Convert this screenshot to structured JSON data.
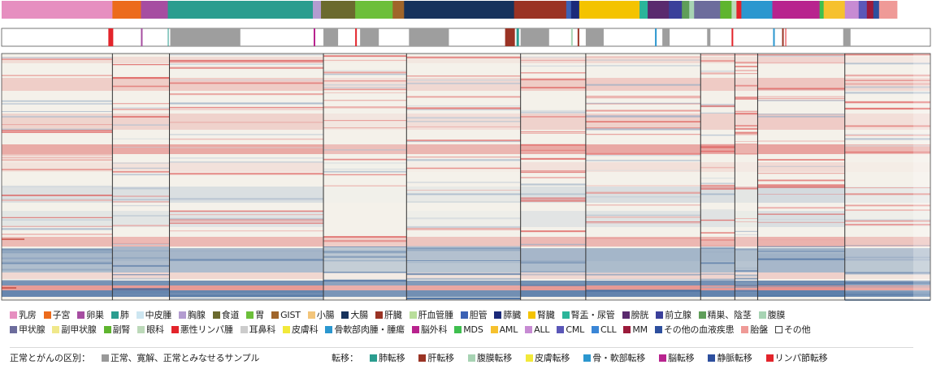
{
  "chart_data": {
    "type": "heatmap",
    "columns": 1140,
    "color_scale": {
      "low": "#1f4f8f",
      "mid": "#f5f3ec",
      "high": "#d72b2b"
    },
    "cancer_types": [
      {
        "label": "乳房",
        "color": "#e68fc0",
        "n": 136
      },
      {
        "label": "子宮",
        "color": "#ec6b1c",
        "n": 35
      },
      {
        "label": "卵巣",
        "color": "#a64da1",
        "n": 33
      },
      {
        "label": "肺",
        "color": "#2a9d8f",
        "n": 178
      },
      {
        "label": "中皮腫",
        "color": "#cde6f1",
        "n": 0
      },
      {
        "label": "胸腺",
        "color": "#b39cd0",
        "n": 10
      },
      {
        "label": "食道",
        "color": "#6b6a2e",
        "n": 42
      },
      {
        "label": "胃",
        "color": "#6cbf3a",
        "n": 46
      },
      {
        "label": "GIST",
        "color": "#a0652a",
        "n": 14
      },
      {
        "label": "小腸",
        "color": "#f3c57a",
        "n": 0
      },
      {
        "label": "大腸",
        "color": "#16325c",
        "n": 135
      },
      {
        "label": "肝臓",
        "color": "#9a3324",
        "n": 64
      },
      {
        "label": "肝血管腫",
        "color": "#b9de9b",
        "n": 0
      },
      {
        "label": "胆管",
        "color": "#3c62b5",
        "n": 6
      },
      {
        "label": "膵臓",
        "color": "#1b2a7a",
        "n": 10
      },
      {
        "label": "腎臓",
        "color": "#f4c300",
        "n": 74
      },
      {
        "label": "腎盂・尿管",
        "color": "#2bb59a",
        "n": 10
      },
      {
        "label": "膀胱",
        "color": "#5a2a6e",
        "n": 26
      },
      {
        "label": "前立腺",
        "color": "#3a3f9a",
        "n": 16
      },
      {
        "label": "精巣、陰茎",
        "color": "#5f9e59",
        "n": 9
      },
      {
        "label": "腹膜",
        "color": "#a7d3b3",
        "n": 6
      },
      {
        "label": "甲状腺",
        "color": "#6c6c9c",
        "n": 32
      },
      {
        "label": "副甲状腺",
        "color": "#f0e88a",
        "n": 0
      },
      {
        "label": "副腎",
        "color": "#5fb52f",
        "n": 14
      },
      {
        "label": "眼科",
        "color": "#bcd9b9",
        "n": 6
      },
      {
        "label": "悪性リンパ腫",
        "color": "#e3242b",
        "n": 6
      },
      {
        "label": "耳鼻科",
        "color": "#cccccc",
        "n": 0
      },
      {
        "label": "皮膚科",
        "color": "#f2e93a",
        "n": 0
      },
      {
        "label": "骨軟部肉腫・腫瘍",
        "color": "#2b97cf",
        "n": 38
      },
      {
        "label": "脳外科",
        "color": "#b8238e",
        "n": 58
      },
      {
        "label": "MDS",
        "color": "#3fbf4f",
        "n": 5
      },
      {
        "label": "AML",
        "color": "#f6c12e",
        "n": 26
      },
      {
        "label": "ALL",
        "color": "#c78bd3",
        "n": 17
      },
      {
        "label": "CML",
        "color": "#5b57b8",
        "n": 10
      },
      {
        "label": "CLL",
        "color": "#3a86d6",
        "n": 0
      },
      {
        "label": "MM",
        "color": "#9b1b3b",
        "n": 8
      },
      {
        "label": "その他の血液疾患",
        "color": "#2d4f9e",
        "n": 7
      },
      {
        "label": "胎盤",
        "color": "#ef9a97",
        "n": 22
      },
      {
        "label": "その他",
        "color": "#ffffff",
        "n": 0,
        "outline": true
      }
    ],
    "cluster_boundaries": [
      136,
      206,
      395,
      497,
      637,
      717,
      858,
      900,
      928,
      1035
    ],
    "annotation_track": {
      "normal_segments": [
        [
          207,
          293
        ],
        [
          395,
          413
        ],
        [
          440,
          463
        ],
        [
          500,
          549
        ],
        [
          637,
          672
        ],
        [
          717,
          739
        ],
        [
          811,
          820
        ],
        [
          866,
          870
        ],
        [
          1033,
          1042
        ]
      ],
      "metastasis_marks": [
        {
          "at": 131,
          "color": "#e3242b",
          "width": 6
        },
        {
          "at": 171,
          "color": "#a64da1",
          "width": 2
        },
        {
          "at": 204,
          "color": "#2a9d8f",
          "width": 1
        },
        {
          "at": 383,
          "color": "#b8238e",
          "width": 2
        },
        {
          "at": 434,
          "color": "#e3242b",
          "width": 2
        },
        {
          "at": 618,
          "color": "#9a3324",
          "width": 12
        },
        {
          "at": 632,
          "color": "#2a9d8f",
          "width": 3
        },
        {
          "at": 699,
          "color": "#a7d3b3",
          "width": 2
        },
        {
          "at": 707,
          "color": "#9a3324",
          "width": 2
        },
        {
          "at": 802,
          "color": "#2b97cf",
          "width": 2
        },
        {
          "at": 896,
          "color": "#e3242b",
          "width": 2
        },
        {
          "at": 947,
          "color": "#2b97cf",
          "width": 2
        },
        {
          "at": 958,
          "color": "#9a3324",
          "width": 2
        },
        {
          "at": 962,
          "color": "#e3242b",
          "width": 1
        }
      ]
    },
    "legend": {
      "normal_group_title": "正常とがんの区別：",
      "normal_items": [
        {
          "label": "正常、寛解、正常とみなせるサンプル",
          "color": "#999999"
        }
      ],
      "metastasis_group_title": "転移：",
      "metastasis_items": [
        {
          "label": "肺転移",
          "color": "#2a9d8f"
        },
        {
          "label": "肝転移",
          "color": "#9a3324"
        },
        {
          "label": "腹膜転移",
          "color": "#a7d3b3"
        },
        {
          "label": "皮膚転移",
          "color": "#f2e93a"
        },
        {
          "label": "骨・軟部転移",
          "color": "#2b97cf"
        },
        {
          "label": "脳転移",
          "color": "#b8238e"
        },
        {
          "label": "静脈転移",
          "color": "#2d4f9e"
        },
        {
          "label": "リンパ節転移",
          "color": "#e3242b"
        }
      ]
    }
  }
}
